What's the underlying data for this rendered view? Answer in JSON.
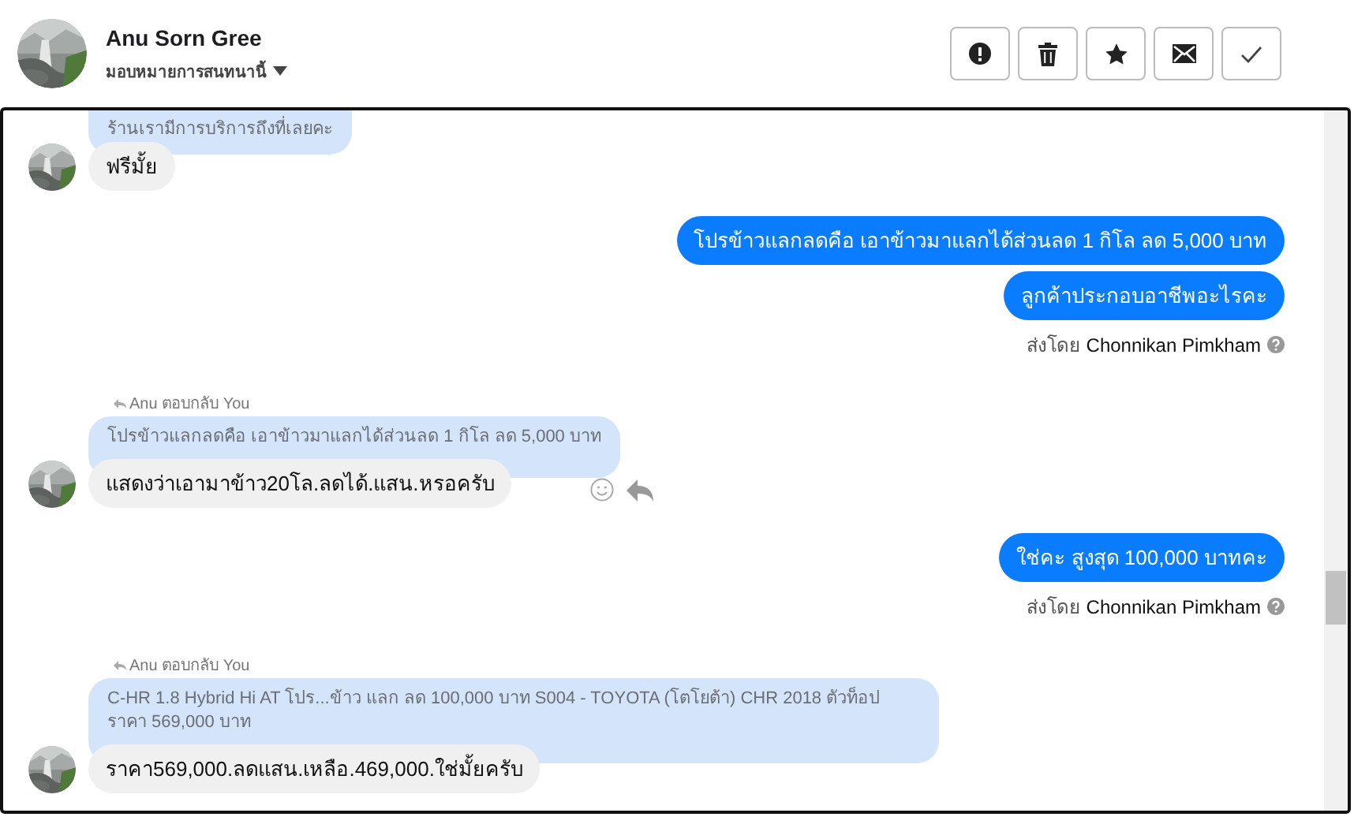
{
  "header": {
    "name": "Anu Sorn Gree",
    "assign_label": "มอบหมายการสนทนานี้",
    "buttons": [
      {
        "kind": "alert"
      },
      {
        "kind": "trash"
      },
      {
        "kind": "star"
      },
      {
        "kind": "mail"
      },
      {
        "kind": "check"
      }
    ]
  },
  "messages": [
    {
      "kind": "quote_cut",
      "text": "ร้านเรามีการบริการถึงที่เลยคะ"
    },
    {
      "kind": "incoming",
      "text": "ฟรีมั้ย",
      "show_actions": false
    },
    {
      "kind": "outgoing",
      "text": "โปรข้าวแลกลดคือ เอาข้าวมาแลกได้ส่วนลด 1 กิโล ลด 5,000 บาท"
    },
    {
      "kind": "outgoing",
      "text": "ลูกค้าประกอบอาชีพอะไรคะ"
    },
    {
      "kind": "sent_by",
      "prefix": "ส่งโดย",
      "name": "Chonnikan Pimkham"
    },
    {
      "kind": "reply_header",
      "text": "Anu ตอบกลับ You"
    },
    {
      "kind": "quote",
      "text": "โปรข้าวแลกลดคือ เอาข้าวมาแลกได้ส่วนลด 1 กิโล ลด 5,000 บาท"
    },
    {
      "kind": "incoming",
      "text": "แสดงว่าเอามาข้าว20โล.ลดได้.แสน.หรอครับ",
      "show_actions": true
    },
    {
      "kind": "outgoing",
      "text": "ใช่คะ สูงสุด 100,000 บาทคะ"
    },
    {
      "kind": "sent_by",
      "prefix": "ส่งโดย",
      "name": "Chonnikan Pimkham"
    },
    {
      "kind": "reply_header",
      "text": "Anu ตอบกลับ You"
    },
    {
      "kind": "quote",
      "text": "C-HR 1.8 Hybrid Hi AT โปร...ข้าว แลก ลด 100,000 บาท S004 - TOYOTA (โตโยต้า) CHR 2018 ตัวท็อป ราคา 569,000 บาท"
    },
    {
      "kind": "incoming",
      "text": "ราคา569,000.ลดแสน.เหลือ.469,000.ใช่มั้ยครับ",
      "show_actions": false
    }
  ]
}
